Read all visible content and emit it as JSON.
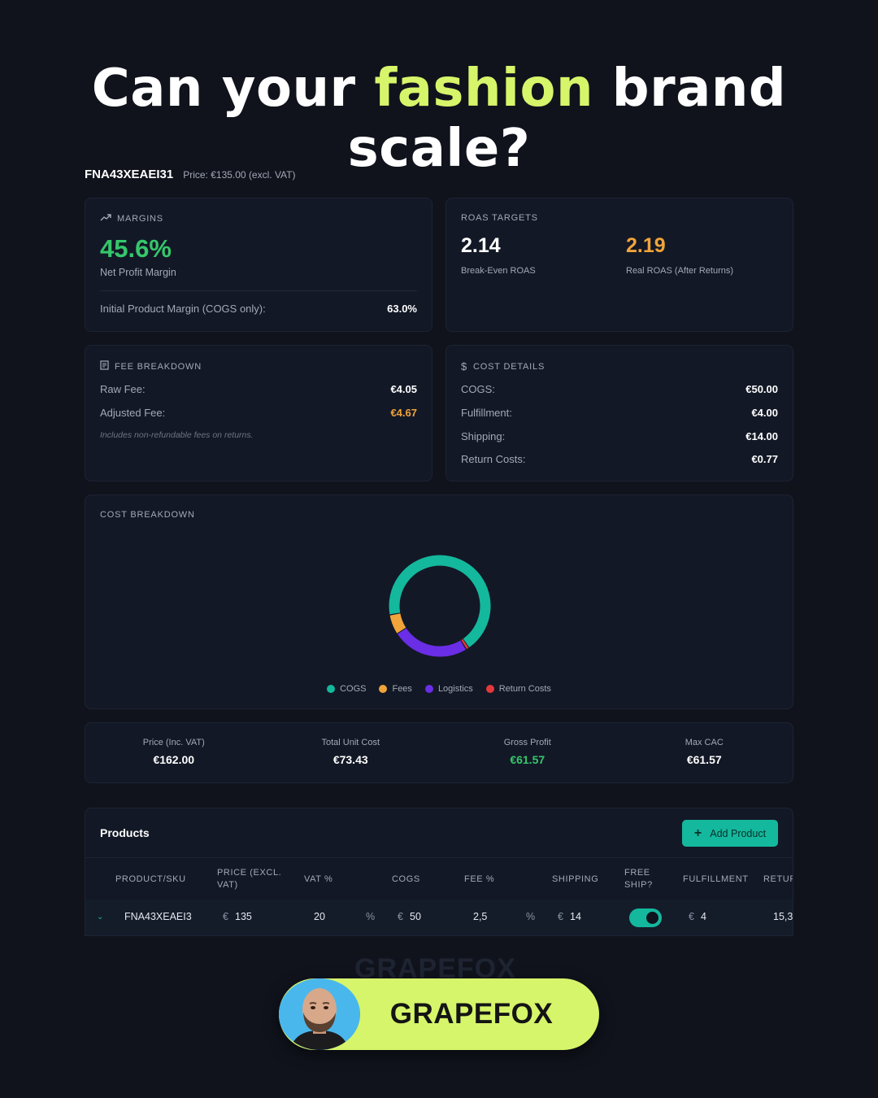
{
  "headline": {
    "pre": "Can your ",
    "accent": "fashion",
    "post": " brand scale?"
  },
  "product": {
    "sku": "FNA43XEAEI31",
    "price_text": "Price: €135.00 (excl. VAT)"
  },
  "margins": {
    "label": "MARGINS",
    "net_margin": "45.6%",
    "net_margin_caption": "Net Profit Margin",
    "initial_label": "Initial Product Margin (COGS only):",
    "initial_value": "63.0%"
  },
  "roas": {
    "label": "ROAS TARGETS",
    "break_even": "2.14",
    "break_even_caption": "Break-Even ROAS",
    "real": "2.19",
    "real_caption": "Real ROAS (After Returns)"
  },
  "fee": {
    "label": "FEE BREAKDOWN",
    "raw_label": "Raw Fee:",
    "raw_value": "€4.05",
    "adjusted_label": "Adjusted Fee:",
    "adjusted_value": "€4.67",
    "note": "Includes non-refundable fees on returns."
  },
  "cost_details": {
    "label": "COST DETAILS",
    "items": [
      {
        "label": "COGS:",
        "value": "€50.00"
      },
      {
        "label": "Fulfillment:",
        "value": "€4.00"
      },
      {
        "label": "Shipping:",
        "value": "€14.00"
      },
      {
        "label": "Return Costs:",
        "value": "€0.77"
      }
    ]
  },
  "breakdown": {
    "label": "COST BREAKDOWN",
    "legend": [
      {
        "name": "COGS",
        "color": "#14b89d"
      },
      {
        "name": "Fees",
        "color": "#f0a43a"
      },
      {
        "name": "Logistics",
        "color": "#6a2ee6"
      },
      {
        "name": "Return Costs",
        "color": "#e5383b"
      }
    ]
  },
  "chart_data": {
    "type": "pie",
    "categories": [
      "COGS",
      "Fees",
      "Logistics",
      "Return Costs"
    ],
    "values": [
      50.0,
      4.67,
      18.0,
      0.77
    ],
    "colors": [
      "#14b89d",
      "#f0a43a",
      "#6a2ee6",
      "#e5383b"
    ],
    "title": "COST BREAKDOWN",
    "legend": "bottom"
  },
  "stats": [
    {
      "label": "Price (Inc. VAT)",
      "value": "€162.00",
      "accent": false
    },
    {
      "label": "Total Unit Cost",
      "value": "€73.43",
      "accent": false
    },
    {
      "label": "Gross Profit",
      "value": "€61.57",
      "accent": true
    },
    {
      "label": "Max CAC",
      "value": "€61.57",
      "accent": false
    }
  ],
  "products": {
    "title": "Products",
    "add_label": "Add Product",
    "columns": [
      "PRODUCT/SKU",
      "PRICE (EXCL. VAT)",
      "VAT %",
      "COGS",
      "FEE %",
      "SHIPPING",
      "FREE SHIP?",
      "FULFILLMENT",
      "RETUR"
    ],
    "row": {
      "sku": "FNA43XEAEI3",
      "price_currency": "€",
      "price": "135",
      "vat": "20",
      "vat_unit": "%",
      "cogs_currency": "€",
      "cogs": "50",
      "fee": "2,5",
      "fee_unit": "%",
      "shipping_currency": "€",
      "shipping": "14",
      "free_ship": true,
      "fulfillment_currency": "€",
      "fulfillment": "4",
      "returns": "15,3"
    }
  },
  "watermark": "GRAPEFOX",
  "brand": {
    "name": "GRAPEFOX",
    "avatar_bg": "#49b7ec",
    "pill_color": "#d6f56a"
  }
}
